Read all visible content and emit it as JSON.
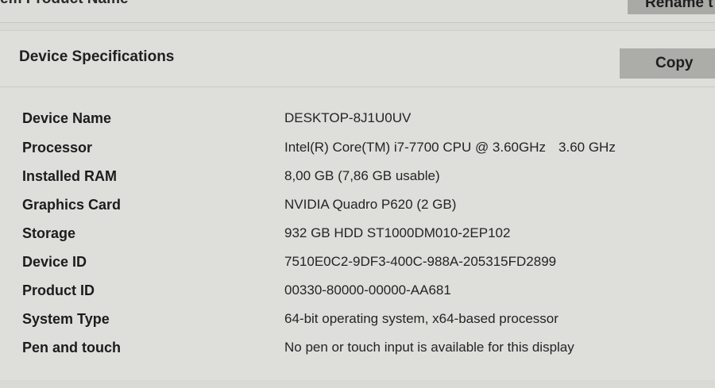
{
  "top": {
    "label": "em Product Name",
    "rename_label": "Rename t"
  },
  "section": {
    "title": "Device Specifications",
    "copy_label": "Copy"
  },
  "specs": [
    {
      "label": "Device Name",
      "value": "DESKTOP-8J1U0UV"
    },
    {
      "label": "Processor",
      "value": "Intel(R) Core(TM) i7-7700 CPU @ 3.60GHz",
      "value_extra": "3.60 GHz"
    },
    {
      "label": "Installed RAM",
      "value": "8,00 GB (7,86 GB usable)"
    },
    {
      "label": "Graphics Card",
      "value": "NVIDIA Quadro P620 (2 GB)"
    },
    {
      "label": "Storage",
      "value": "932 GB HDD ST1000DM010-2EP102"
    },
    {
      "label": "Device ID",
      "value": "7510E0C2-9DF3-400C-988A-205315FD2899"
    },
    {
      "label": "Product ID",
      "value": "00330-80000-00000-AA681"
    },
    {
      "label": "System Type",
      "value": "64-bit operating system, x64-based processor"
    },
    {
      "label": "Pen and touch",
      "value": "No pen or touch input is available for this display"
    }
  ]
}
